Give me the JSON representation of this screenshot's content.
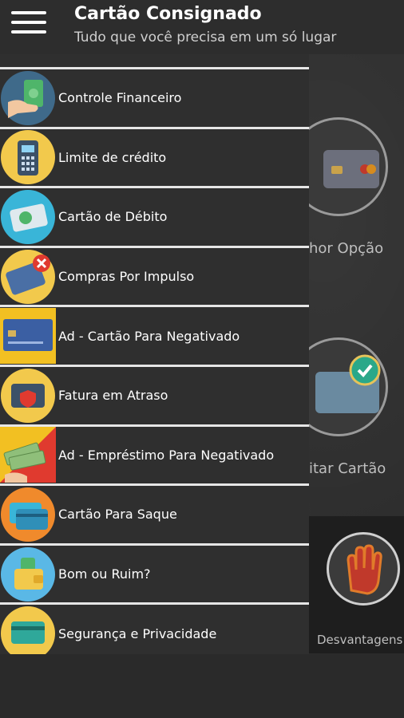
{
  "header": {
    "title": "Cartão Consignado",
    "subtitle": "Tudo que você precisa em um só lugar"
  },
  "background": {
    "label_1": "hor Opção",
    "label_2": "itar Cartão",
    "label_3": "Desvantagens"
  },
  "drawer": {
    "items": [
      {
        "label": "Controle Financeiro",
        "icon": "money-hand-icon",
        "color": "#3f6a8a"
      },
      {
        "label": "Limite de crédito",
        "icon": "card-machine-icon",
        "color": "#f2c94c"
      },
      {
        "label": "Cartão de Débito",
        "icon": "debit-card-icon",
        "color": "#39b5d8"
      },
      {
        "label": "Compras Por Impulso",
        "icon": "impulse-card-icon",
        "color": "#f2c94c"
      },
      {
        "label": "Ad - Cartão Para Negativado",
        "icon": "platinum-card-icon",
        "color": "#f2c022"
      },
      {
        "label": "Fatura em Atraso",
        "icon": "overdue-bill-icon",
        "color": "#f2c94c"
      },
      {
        "label": "Ad - Empréstimo Para Negativado",
        "icon": "cash-loan-icon",
        "color": "#e03a2f"
      },
      {
        "label": "Cartão Para Saque",
        "icon": "withdraw-card-icon",
        "color": "#f08a2c"
      },
      {
        "label": "Bom ou Ruim?",
        "icon": "wallet-icon",
        "color": "#5ab8e6"
      },
      {
        "label": "Segurança e Privacidade",
        "icon": "security-card-icon",
        "color": "#f2c94c"
      }
    ]
  }
}
